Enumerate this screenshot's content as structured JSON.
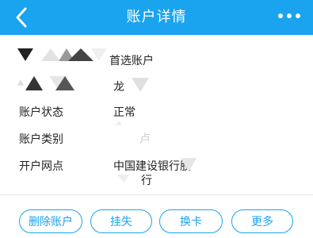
{
  "header": {
    "title": "账户详情",
    "back_icon": "chevron-left-icon",
    "more_icon": "more-dots-icon",
    "background": "#1aa3ef"
  },
  "account": {
    "primary_tag": "首选账户",
    "name_partial": "龙",
    "rows": [
      {
        "label": "账户状态",
        "value": "正常"
      },
      {
        "label": "账户类别",
        "value": "卢"
      },
      {
        "label": "开户网点",
        "value_line1": "中国建设银行股",
        "value_line2": "行"
      }
    ]
  },
  "actions": [
    {
      "label": "删除账户"
    },
    {
      "label": "挂失"
    },
    {
      "label": "换卡"
    },
    {
      "label": "更多"
    }
  ],
  "accent": "#1aa3ef"
}
